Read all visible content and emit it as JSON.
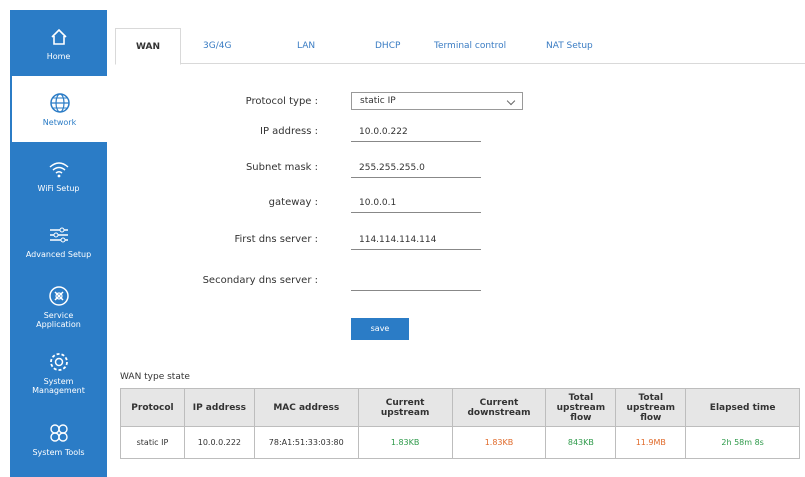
{
  "sidebar": {
    "items": [
      {
        "label": "Home",
        "icon": "home-icon"
      },
      {
        "label": "Network",
        "icon": "globe-icon"
      },
      {
        "label": "WiFi Setup",
        "icon": "wifi-icon"
      },
      {
        "label": "Advanced Setup",
        "icon": "sliders-icon"
      },
      {
        "label": "Service Application",
        "icon": "service-icon"
      },
      {
        "label": "System Management",
        "icon": "gear-icon"
      },
      {
        "label": "System Tools",
        "icon": "tools-icon"
      }
    ],
    "active_index": 1,
    "color": "#2b7cc6"
  },
  "tabs": [
    {
      "label": "WAN"
    },
    {
      "label": "3G/4G"
    },
    {
      "label": "LAN"
    },
    {
      "label": "DHCP"
    },
    {
      "label": "Terminal control"
    },
    {
      "label": "NAT Setup"
    }
  ],
  "form": {
    "protocol_type_label": "Protocol type :",
    "protocol_type_value": "static IP",
    "ip_label": "IP address :",
    "ip_value": "10.0.0.222",
    "subnet_label": "Subnet mask :",
    "subnet_value": "255.255.255.0",
    "gateway_label": "gateway :",
    "gateway_value": "10.0.0.1",
    "dns1_label": "First dns server :",
    "dns1_value": "114.114.114.114",
    "dns2_label": "Secondary dns server :",
    "dns2_value": "",
    "save_label": "save"
  },
  "state": {
    "title": "WAN type state",
    "headers": [
      "Protocol",
      "IP address",
      "MAC address",
      "Current upstream",
      "Current downstream",
      "Total upstream flow",
      "Total upstream flow",
      "Elapsed time"
    ],
    "row": [
      "static IP",
      "10.0.0.222",
      "78:A1:51:33:03:80",
      "1.83KB",
      "1.83KB",
      "843KB",
      "11.9MB",
      "2h 58m 8s"
    ]
  }
}
